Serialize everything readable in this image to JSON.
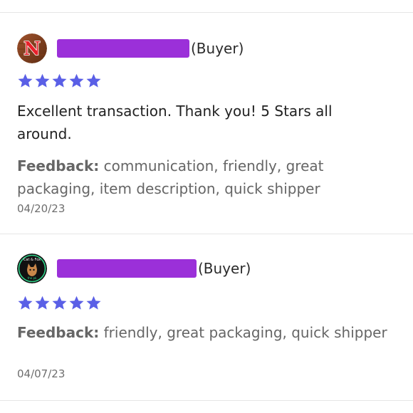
{
  "colors": {
    "star": "#5a5fe6",
    "redaction": "#9b30d9",
    "divider": "#e6e6e6"
  },
  "reviews": [
    {
      "avatar_icon": "nebraska-n-logo-icon",
      "role": "(Buyer)",
      "rating": 5,
      "comment": "Excellent transaction. Thank you! 5 Stars all around.",
      "feedback_label": "Feedback:",
      "feedback_tags": "communication, friendly, great packaging, item description, quick shipper",
      "date": "04/20/23"
    },
    {
      "avatar_icon": "cat-shop-logo-icon",
      "avatar_text": "the pk",
      "role": "(Buyer)",
      "rating": 5,
      "feedback_label": "Feedback:",
      "feedback_tags": "friendly, great packaging, quick shipper",
      "date": "04/07/23"
    }
  ]
}
